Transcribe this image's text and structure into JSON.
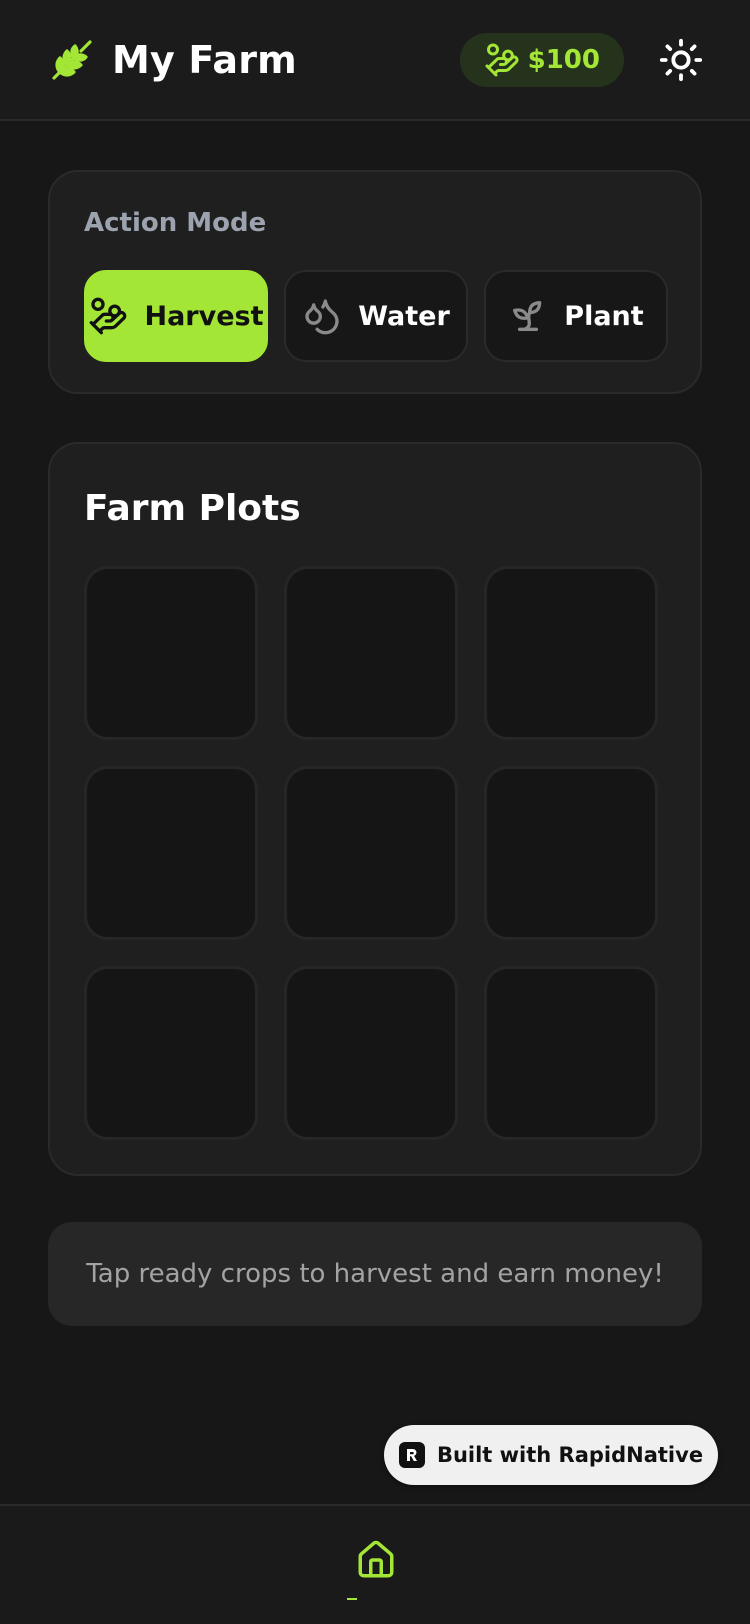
{
  "header": {
    "title": "My Farm",
    "logo_icon": "wheat-icon",
    "money": "$100",
    "money_icon": "hand-coins-icon",
    "theme_icon": "sun-icon"
  },
  "action_mode": {
    "label": "Action Mode",
    "modes": [
      {
        "label": "Harvest",
        "icon": "hand-harvest-icon",
        "active": true
      },
      {
        "label": "Water",
        "icon": "droplets-icon",
        "active": false
      },
      {
        "label": "Plant",
        "icon": "sprout-icon",
        "active": false
      }
    ]
  },
  "plots": {
    "title": "Farm Plots",
    "count": 9
  },
  "hint": "Tap ready crops to harvest and earn money!",
  "badge": {
    "label": "Built with RapidNative"
  },
  "tabbar": {
    "home_icon": "home-icon"
  },
  "colors": {
    "accent": "#a3e635",
    "background": "#171717",
    "card": "#1f1f1f",
    "muted": "#9ca3af"
  }
}
